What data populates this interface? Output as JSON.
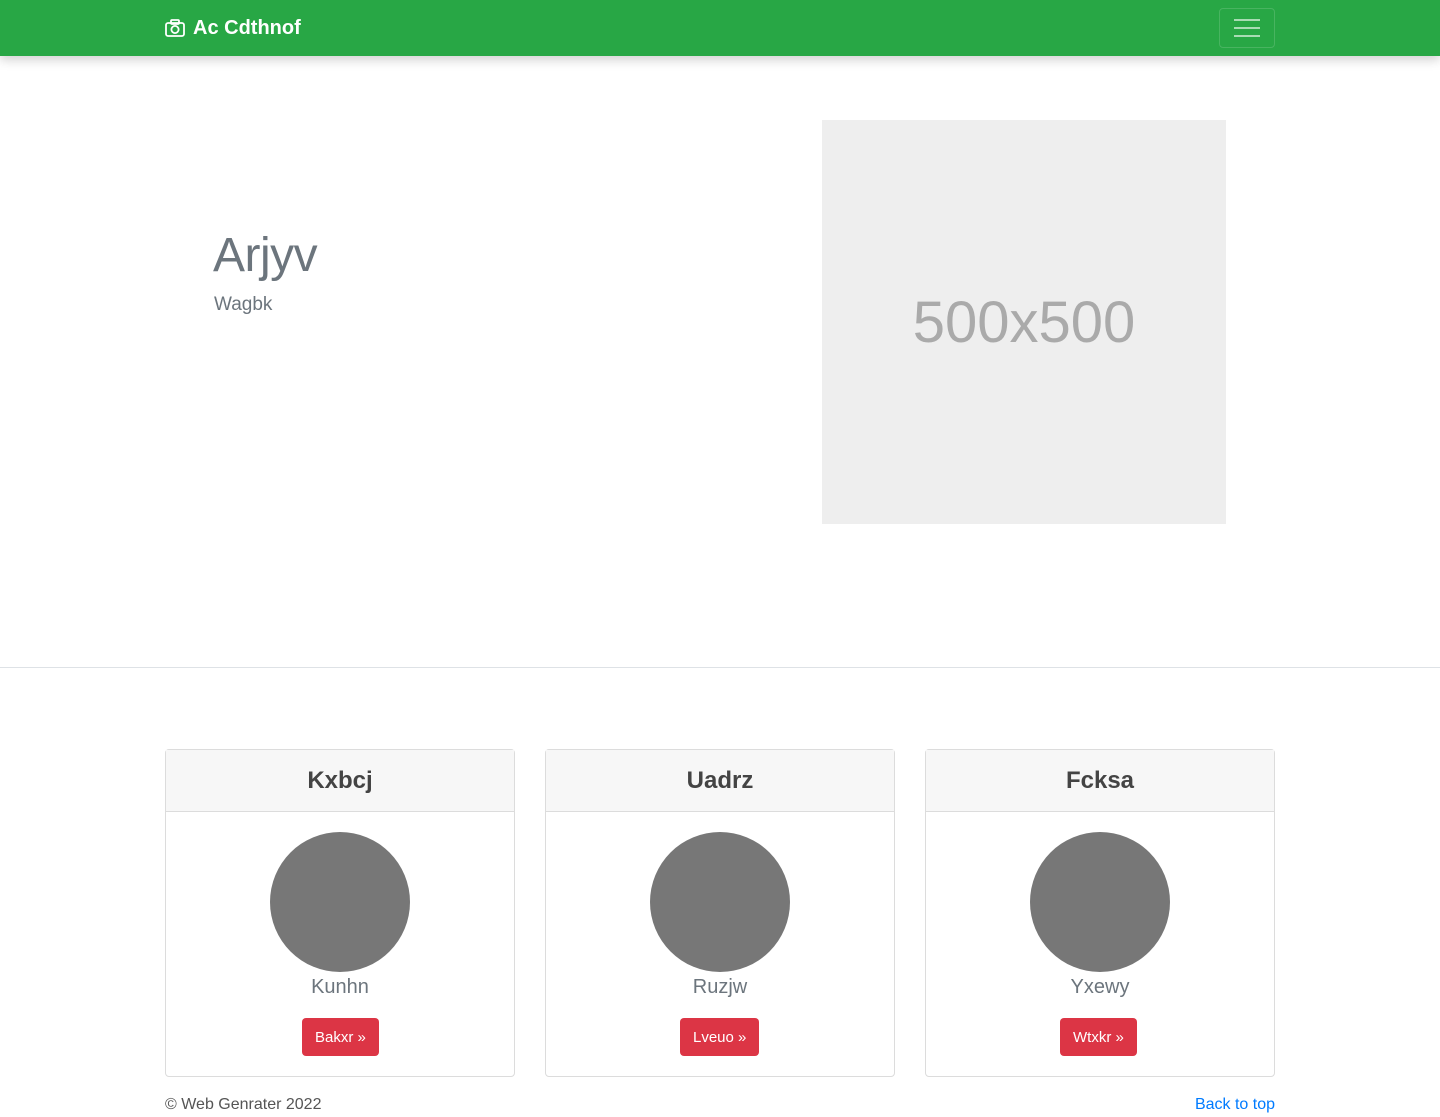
{
  "navbar": {
    "brand": "Ac Cdthnof",
    "brand_icon": "camera-icon",
    "toggler_icon": "hamburger-icon",
    "color": "#28a745"
  },
  "hero": {
    "title": "Arjyv",
    "subtitle": "Wagbk",
    "placeholder_text": "500x500"
  },
  "cards": [
    {
      "title": "Kxbcj",
      "name": "Kunhn",
      "button": "Bakxr »"
    },
    {
      "title": "Uadrz",
      "name": "Ruzjw",
      "button": "Lveuo »"
    },
    {
      "title": "Fcksa",
      "name": "Yxewy",
      "button": "Wtxkr »"
    }
  ],
  "footer": {
    "copyright": "© Web Genrater 2022",
    "back_to_top": "Back to top"
  },
  "colors": {
    "button": "#dc3545",
    "link": "#007bff"
  }
}
